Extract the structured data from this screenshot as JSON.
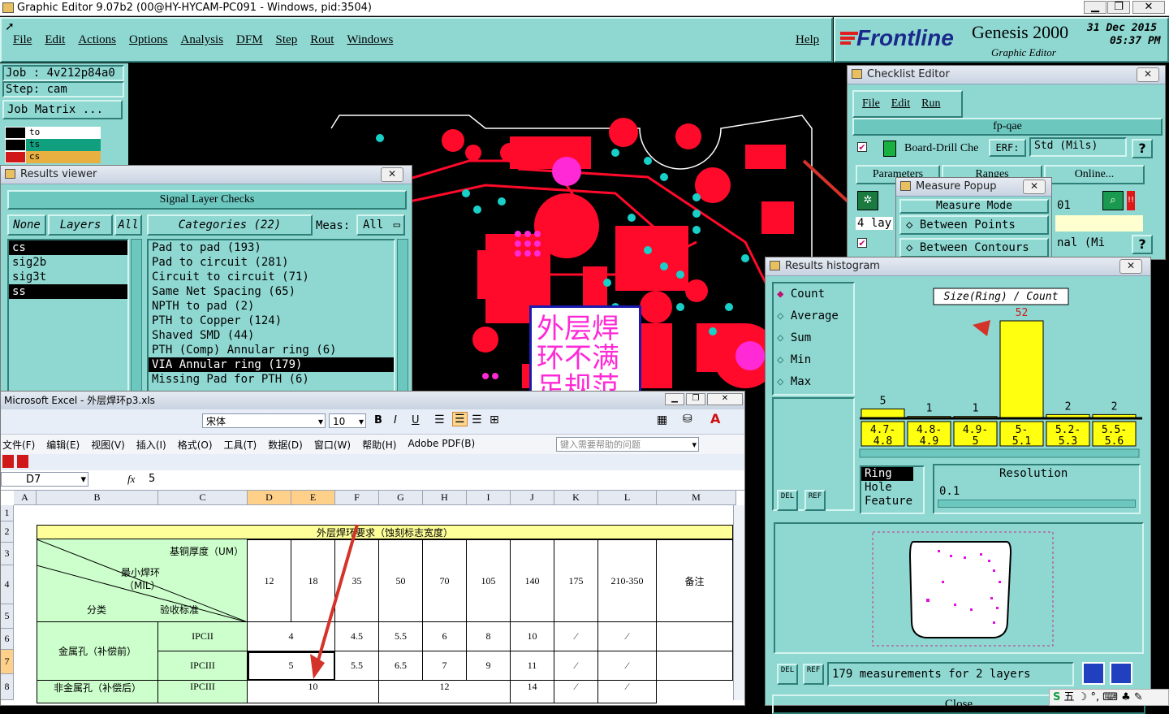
{
  "window_title": "Graphic Editor 9.07b2 (00@HY-HYCAM-PC091 - Windows, pid:3504)",
  "menu": [
    "File",
    "Edit",
    "Actions",
    "Options",
    "Analysis",
    "DFM",
    "Step",
    "Rout",
    "Windows"
  ],
  "help": "Help",
  "brand": {
    "logo": "Frontline",
    "product": "Genesis 2000",
    "subtitle": "Graphic Editor",
    "date": "31 Dec 2015",
    "time": "05:37 PM"
  },
  "job": {
    "job": "Job : 4v212p84a0",
    "step": "Step: cam",
    "matrix": "Job Matrix ..."
  },
  "layers_mini": [
    "to",
    "ts",
    "cs"
  ],
  "results_viewer": {
    "title": "Results viewer",
    "header": "Signal Layer Checks",
    "btn_none": "None",
    "btn_layers": "Layers",
    "btn_all": "All",
    "categories": "Categories (22)",
    "meas_label": "Meas:",
    "meas_value": "All",
    "layers": [
      "cs",
      "sig2b",
      "sig3t",
      "ss"
    ],
    "items": [
      "Pad to pad (193)",
      "Pad to circuit (281)",
      "Circuit to circuit (71)",
      "Same Net Spacing (65)",
      "NPTH to pad (2)",
      "PTH to Copper (124)",
      "Shaved SMD (44)",
      "PTH (Comp) Annular ring (6)",
      "VIA Annular ring (179)",
      "Missing Pad for PTH (6)"
    ]
  },
  "annotation": {
    "line1": "外层焊",
    "line2": "环不满",
    "line3": "足规范"
  },
  "checklist": {
    "title": "Checklist Editor",
    "menu": [
      "File",
      "Edit",
      "Run"
    ],
    "name": "fp-qae",
    "row1": "Board-Drill Che",
    "erf": "ERF:",
    "units": "Std (Mils)",
    "q": "?",
    "tabs": [
      "Parameters",
      "Ranges",
      "Online..."
    ],
    "row2_num": "01",
    "row3_lay": "4 lay",
    "row4_txt": "nal (Mi"
  },
  "measure_popup": {
    "title": "Measure Popup",
    "mode": "Measure Mode",
    "opt1": "Between Points",
    "opt2": "Between Contours"
  },
  "histogram": {
    "title": "Results histogram",
    "modes": [
      "Count",
      "Average",
      "Sum",
      "Min",
      "Max"
    ],
    "chart_label": "Size(Ring) / Count",
    "props": [
      "Ring",
      "Hole",
      "Feature"
    ],
    "resolution_label": "Resolution",
    "resolution_value": "0.1",
    "del": "DEL",
    "ref": "REF",
    "status": "179 measurements for 2 layers",
    "close": "Close"
  },
  "chart_data": {
    "type": "bar",
    "categories": [
      "4.7-4.8",
      "4.8-4.9",
      "4.9-5",
      "5-5.1",
      "5.2-5.3",
      "5.5-5.6"
    ],
    "values": [
      5,
      1,
      1,
      52,
      2,
      2
    ],
    "title": "Size(Ring) / Count"
  },
  "excel": {
    "title": "Microsoft Excel - 外层焊环p3.xls",
    "font": "宋体",
    "size": "10",
    "menu": [
      "文件(F)",
      "编辑(E)",
      "视图(V)",
      "插入(I)",
      "格式(O)",
      "工具(T)",
      "数据(D)",
      "窗口(W)",
      "帮助(H)",
      "Adobe PDF(B)"
    ],
    "help_box": "键入需要帮助的问题",
    "cell_ref": "D7",
    "fx": "fx",
    "formula": "5",
    "cols": [
      "A",
      "B",
      "C",
      "D",
      "E",
      "F",
      "G",
      "H",
      "I",
      "J",
      "K",
      "L",
      "M"
    ],
    "rows": [
      "1",
      "2",
      "3",
      "4",
      "5",
      "6",
      "7",
      "8"
    ],
    "table_title": "外层焊环要求（蚀刻标志宽度）",
    "hdr_thick": "基铜厚度（UM）",
    "hdr_min1": "最小焊环",
    "hdr_min2": "（MIL）",
    "hdr_cls": "分类",
    "hdr_std": "验收标准",
    "thick": [
      "12",
      "18",
      "35",
      "50",
      "70",
      "105",
      "140",
      "175",
      "210-350"
    ],
    "note": "备注",
    "metal": "金属孔（补偿前）",
    "nonmetal": "非金属孔（补偿后）",
    "ipc2": "IPCII",
    "ipc3": "IPCIII",
    "r6": [
      "4",
      "4.5",
      "5.5",
      "6",
      "8",
      "10",
      "⁄",
      "⁄"
    ],
    "r7": [
      "5",
      "5.5",
      "6.5",
      "7",
      "9",
      "11",
      "⁄",
      "⁄"
    ],
    "r8": [
      "10",
      "12",
      "14",
      "⁄",
      "⁄"
    ]
  },
  "taskbar": "五"
}
